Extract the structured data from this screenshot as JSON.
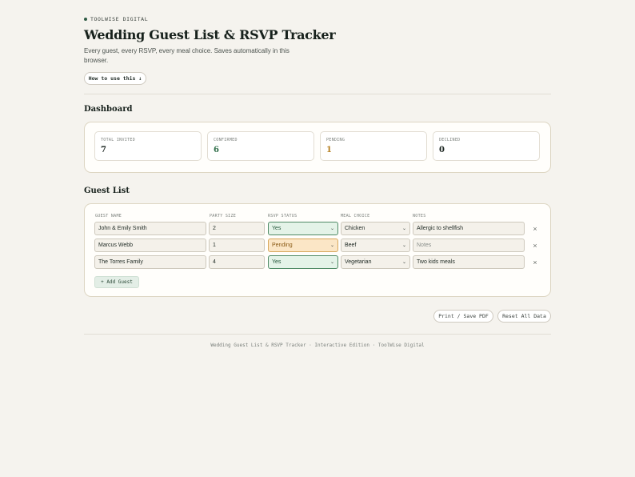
{
  "header": {
    "brand": "TOOLWISE DIGITAL",
    "title": "Wedding Guest List & RSVP Tracker",
    "subtitle": "Every guest, every RSVP, every meal choice. Saves automatically in this browser.",
    "how_to": "How to use this ↓"
  },
  "dashboard": {
    "title": "Dashboard",
    "stats": [
      {
        "label": "TOTAL INVITED",
        "value": "7",
        "color": "#17211c"
      },
      {
        "label": "CONFIRMED",
        "value": "6",
        "color": "#2f6e49"
      },
      {
        "label": "PENDING",
        "value": "1",
        "color": "#b57f1f"
      },
      {
        "label": "DECLINED",
        "value": "0",
        "color": "#17211c"
      }
    ]
  },
  "guest_list": {
    "title": "Guest List",
    "columns": [
      "GUEST NAME",
      "PARTY SIZE",
      "RSVP STATUS",
      "MEAL CHOICE",
      "NOTES"
    ],
    "rows": [
      {
        "name": "John & Emily Smith",
        "party_size": "2",
        "rsvp": "Yes",
        "meal": "Chicken",
        "notes": "Allergic to shellfish"
      },
      {
        "name": "Marcus Webb",
        "party_size": "1",
        "rsvp": "Pending",
        "meal": "Beef",
        "notes": ""
      },
      {
        "name": "The Torres Family",
        "party_size": "4",
        "rsvp": "Yes",
        "meal": "Vegetarian",
        "notes": "Two kids meals"
      }
    ],
    "notes_placeholder": "Notes",
    "add_label": "+ Add Guest",
    "remove_glyph": "×"
  },
  "actions": {
    "print": "Print / Save PDF",
    "reset": "Reset All Data"
  },
  "footer": "Wedding Guest List & RSVP Tracker · Interactive Edition · ToolWise Digital"
}
